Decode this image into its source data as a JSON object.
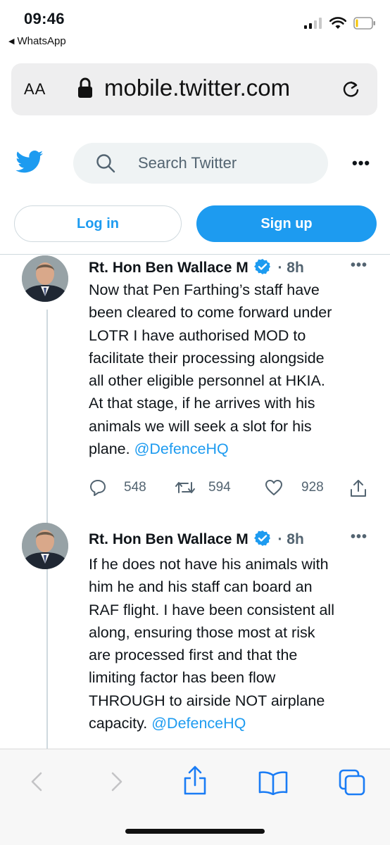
{
  "status_bar": {
    "time": "09:46",
    "back_app": "WhatsApp"
  },
  "browser": {
    "text_size_label": "AA",
    "url": "mobile.twitter.com"
  },
  "twitter": {
    "search_placeholder": "Search Twitter",
    "more_label": "•••",
    "login_label": "Log in",
    "signup_label": "Sign up"
  },
  "tweets": [
    {
      "author": "Rt. Hon Ben Wallace M",
      "time": "· 8h",
      "lines": [
        "Now that Pen Farthing’s staff have",
        "been cleared to come forward under",
        "LOTR I have authorised MOD to",
        "facilitate their processing alongside",
        "all other eligible personnel at HKIA.",
        "At that stage, if he arrives with his",
        "animals we will seek a slot for his"
      ],
      "last_line_prefix": "plane. ",
      "mention": "@DefenceHQ",
      "replies": "548",
      "retweets": "594",
      "likes": "928"
    },
    {
      "author": "Rt. Hon Ben Wallace M",
      "time": "· 8h",
      "lines": [
        "If he does not have his animals with",
        "him he and his staff can board an",
        "RAF flight. I have been consistent all",
        "along, ensuring those most at risk",
        "are processed first and that the",
        "limiting factor has been flow",
        "THROUGH to airside NOT airplane"
      ],
      "last_line_prefix": "capacity. ",
      "mention": "@DefenceHQ"
    }
  ],
  "colors": {
    "twitter_blue": "#1d9bf0",
    "text": "#0f1419",
    "muted": "#536471",
    "safari_blue": "#1a7cf5"
  },
  "icons": {
    "status": [
      "cellular-signal-icon",
      "wifi-icon",
      "battery-icon"
    ],
    "browser": [
      "lock-icon",
      "reload-icon"
    ],
    "safari_toolbar": [
      "back-arrow-icon",
      "forward-arrow-icon",
      "share-icon",
      "bookmarks-icon",
      "tabs-icon"
    ]
  }
}
